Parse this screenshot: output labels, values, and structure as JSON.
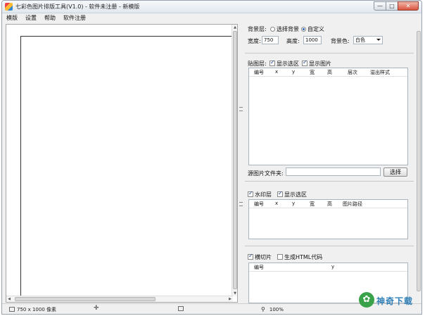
{
  "window": {
    "title": "七彩色图片排版工具(V1.0) - 软件未注册 - 新模版",
    "buttons": {
      "minimize": "—",
      "maximize": "□",
      "close": "✕"
    }
  },
  "menu": [
    "模版",
    "设置",
    "帮助",
    "软件注册"
  ],
  "background_layer": {
    "label": "背景层:",
    "option_image": "选择背景",
    "option_custom": "自定义",
    "selected": "自定义",
    "width_label": "宽度:",
    "width_value": "750",
    "height_label": "高度:",
    "height_value": "1000",
    "color_label": "背景色:",
    "color_value": "白色"
  },
  "sticker_layer": {
    "label": "贴图层:",
    "show_selection": "显示选区",
    "show_image": "显示图片",
    "columns": [
      "编号",
      "x",
      "y",
      "宽",
      "高",
      "层次",
      "溢出样式"
    ]
  },
  "source_folder": {
    "label": "源图片文件夹:",
    "value": "",
    "button": "选择"
  },
  "watermark_layer": {
    "label": "水印层",
    "show_selection": "显示选区",
    "columns": [
      "编号",
      "x",
      "y",
      "宽",
      "高",
      "图片路径"
    ]
  },
  "slice_layer": {
    "label": "横切片",
    "html_option": "生成HTML代码",
    "columns": [
      "编号",
      "y"
    ]
  },
  "status": {
    "size": "750 x 1000 像素",
    "zoom": "100%"
  },
  "brand": {
    "text": "神奇下载",
    "icon": "✿"
  },
  "icons": [
    "app-icon",
    "page-size-icon",
    "move-icon",
    "selection-icon",
    "zoom-icon"
  ]
}
